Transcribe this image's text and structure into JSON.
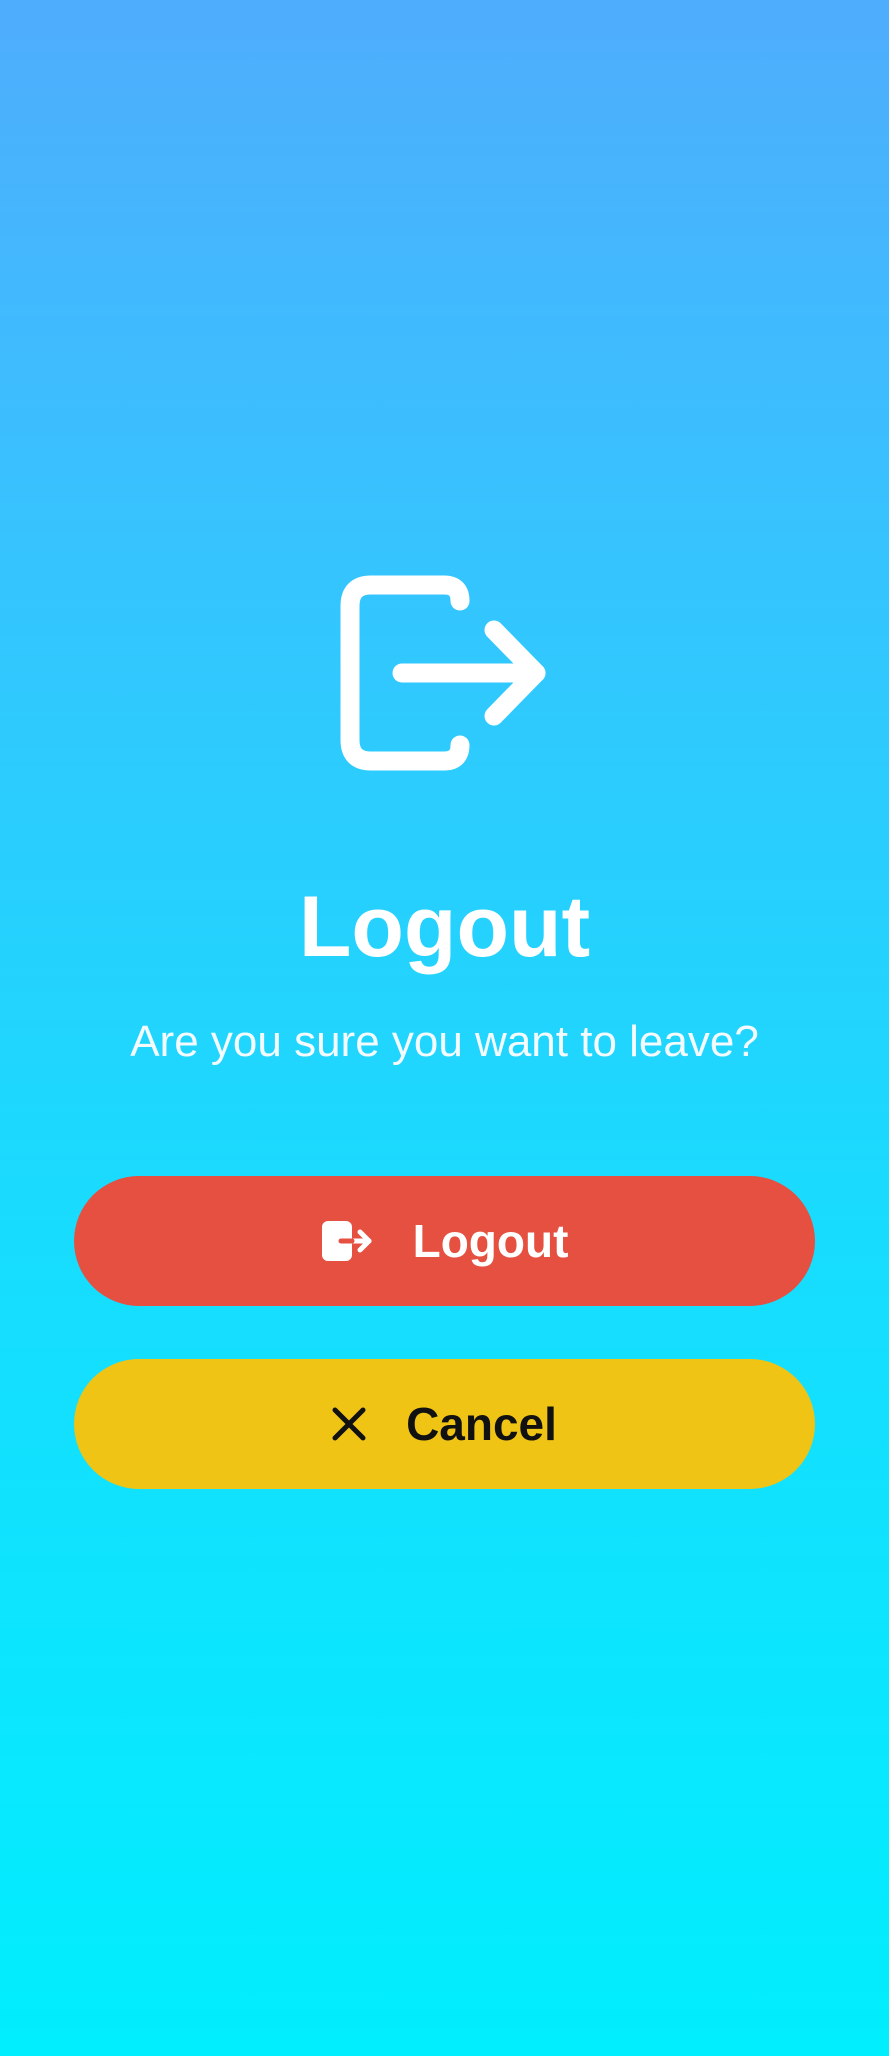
{
  "header": {
    "icon": "logout-icon",
    "title": "Logout",
    "subtitle": "Are you sure you want to leave?"
  },
  "actions": {
    "logout": {
      "label": "Logout",
      "icon": "logout-icon",
      "color": "#E55040"
    },
    "cancel": {
      "label": "Cancel",
      "icon": "close-icon",
      "color": "#F0C414"
    }
  },
  "theme": {
    "gradient_top": "#4FADFD",
    "gradient_bottom": "#00EEFE",
    "text": "#FFFFFF"
  }
}
